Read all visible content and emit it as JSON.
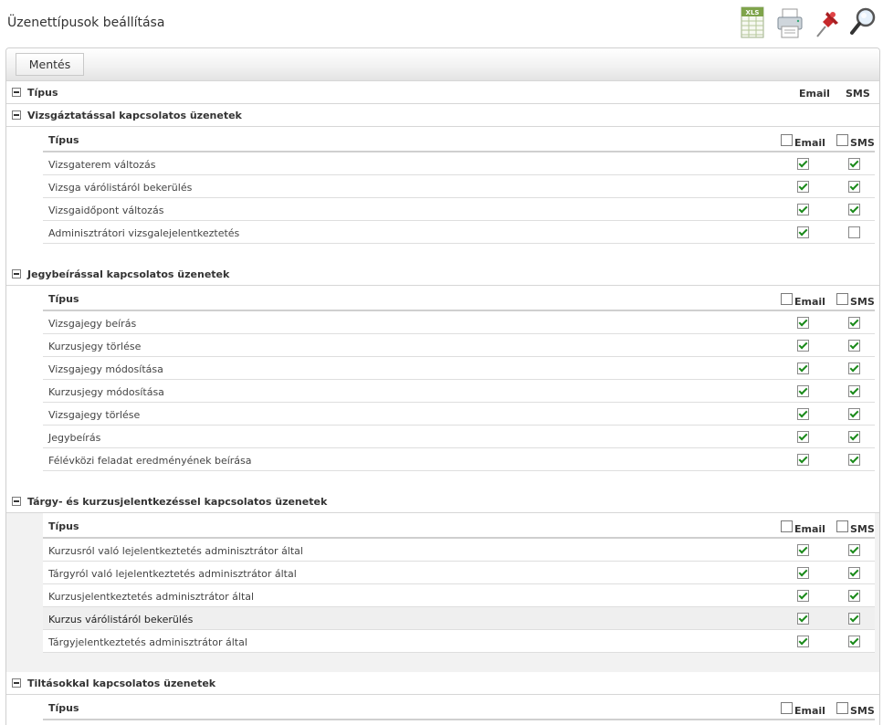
{
  "page": {
    "title": "Üzenettípusok beállítása"
  },
  "toolbar": {
    "xls_text": "XLS",
    "icons": [
      "excel-export-icon",
      "print-icon",
      "pin-icon",
      "search-icon"
    ],
    "save_label": "Mentés"
  },
  "table_header": {
    "type_label": "Típus",
    "email_label": "Email",
    "sms_label": "SMS"
  },
  "groups": [
    {
      "title": "Vizsgáztatással kapcsolatos üzenetek",
      "col_type": "Típus",
      "col_email": "Email",
      "col_sms": "SMS",
      "email_all_checked": false,
      "sms_all_checked": false,
      "rows": [
        {
          "label": "Vizsgaterem változás",
          "email": true,
          "sms": true
        },
        {
          "label": "Vizsga várólistáról bekerülés",
          "email": true,
          "sms": true
        },
        {
          "label": "Vizsgaidőpont változás",
          "email": true,
          "sms": true
        },
        {
          "label": "Adminisztrátori vizsgalejelentkeztetés",
          "email": true,
          "sms": false
        }
      ]
    },
    {
      "title": "Jegybeírással kapcsolatos üzenetek",
      "col_type": "Típus",
      "col_email": "Email",
      "col_sms": "SMS",
      "email_all_checked": false,
      "sms_all_checked": false,
      "rows": [
        {
          "label": "Vizsgajegy beírás",
          "email": true,
          "sms": true
        },
        {
          "label": "Kurzusjegy törlése",
          "email": true,
          "sms": true
        },
        {
          "label": "Vizsgajegy módosítása",
          "email": true,
          "sms": true
        },
        {
          "label": "Kurzusjegy módosítása",
          "email": true,
          "sms": true
        },
        {
          "label": "Vizsgajegy törlése",
          "email": true,
          "sms": true
        },
        {
          "label": "Jegybeírás",
          "email": true,
          "sms": true
        },
        {
          "label": "Félévközi feladat eredményének beírása",
          "email": true,
          "sms": true
        }
      ]
    },
    {
      "title": "Tárgy- és kurzusjelentkezéssel kapcsolatos üzenetek",
      "col_type": "Típus",
      "col_email": "Email",
      "col_sms": "SMS",
      "email_all_checked": false,
      "sms_all_checked": false,
      "rows": [
        {
          "label": "Kurzusról való lejelentkeztetés adminisztrátor által",
          "email": true,
          "sms": true
        },
        {
          "label": "Tárgyról való lejelentkeztetés adminisztrátor által",
          "email": true,
          "sms": true
        },
        {
          "label": "Kurzusjelentkeztetés adminisztrátor által",
          "email": true,
          "sms": true
        },
        {
          "label": "Kurzus várólistáról bekerülés",
          "email": true,
          "sms": true
        },
        {
          "label": "Tárgyjelentkeztetés adminisztrátor által",
          "email": true,
          "sms": true
        }
      ]
    },
    {
      "title": "Tiltásokkal kapcsolatos üzenetek",
      "col_type": "Típus",
      "col_email": "Email",
      "col_sms": "SMS",
      "email_all_checked": false,
      "sms_all_checked": false,
      "rows": []
    }
  ],
  "colors": {
    "check": "#1a8a1a",
    "border": "#d6d6d6",
    "row_highlight": "#efefef"
  }
}
